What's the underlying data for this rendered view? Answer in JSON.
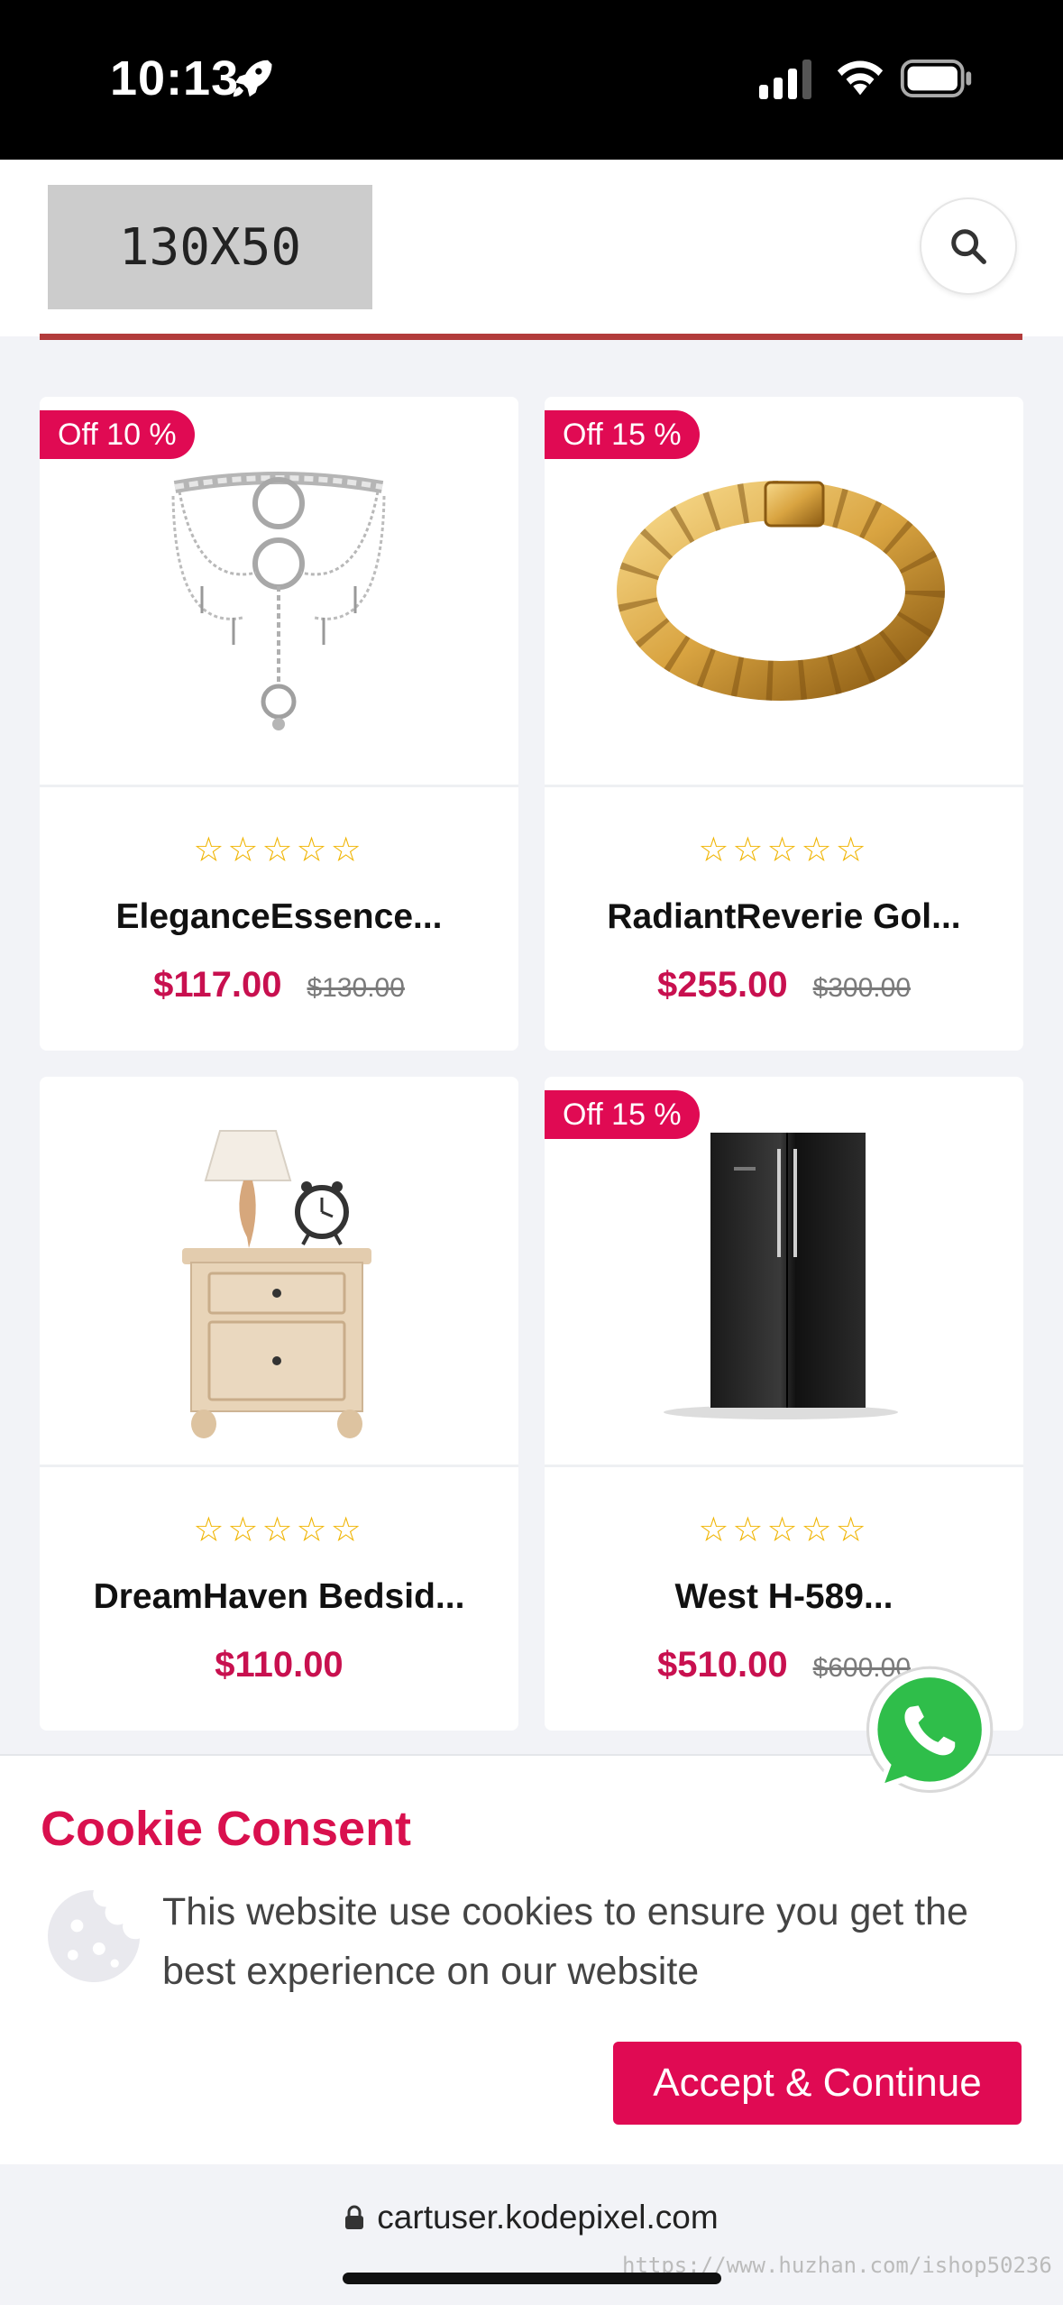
{
  "status_bar": {
    "time": "10:13"
  },
  "header": {
    "logo_text": "130X50",
    "search_icon": "search-icon"
  },
  "products": [
    {
      "badge": "Off 10 %",
      "name": "EleganceEssence...",
      "price": "$117.00",
      "old_price": "$130.00",
      "stars": "☆☆☆☆☆",
      "image_icon": "silver-necklace-image"
    },
    {
      "badge": "Off 15 %",
      "name": "RadiantReverie Gol...",
      "price": "$255.00",
      "old_price": "$300.00",
      "stars": "☆☆☆☆☆",
      "image_icon": "gold-bracelet-image"
    },
    {
      "badge": "",
      "name": "DreamHaven Bedsid...",
      "price": "$110.00",
      "old_price": "",
      "stars": "☆☆☆☆☆",
      "image_icon": "bedside-table-image"
    },
    {
      "badge": "Off 15 %",
      "name": "West H-589...",
      "price": "$510.00",
      "old_price": "$600.00",
      "stars": "☆☆☆☆☆",
      "image_icon": "refrigerator-image"
    }
  ],
  "cookie": {
    "title": "Cookie Consent",
    "text": "This website use cookies to ensure you get the best experience on our website",
    "accept_label": "Accept & Continue"
  },
  "browser": {
    "url": "cartuser.kodepixel.com",
    "watermark": "https://www.huzhan.com/ishop50236"
  },
  "colors": {
    "accent": "#e00a53",
    "price": "#c8104f",
    "star": "#f0b400",
    "header_line": "#b23b3b"
  }
}
